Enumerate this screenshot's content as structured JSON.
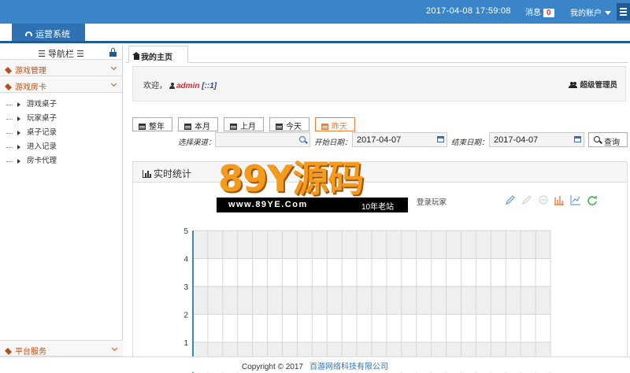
{
  "header": {
    "datetime": "2017-04-08 17:59:08",
    "messages_label": "消息",
    "messages_count": "0",
    "account_label": "我的账户"
  },
  "nav": {
    "system_tab": "运营系统"
  },
  "sidebar": {
    "title": "☰ 导航栏 ☰",
    "groups": [
      {
        "label": "游戏管理"
      },
      {
        "label": "游戏房卡"
      },
      {
        "label": "平台服务"
      }
    ],
    "items": [
      {
        "label": "游戏桌子"
      },
      {
        "label": "玩家桌子"
      },
      {
        "label": "桌子记录"
      },
      {
        "label": "进入记录"
      },
      {
        "label": "房卡代理"
      }
    ]
  },
  "tabs": {
    "home": "我的主页"
  },
  "welcome": {
    "greeting": "欢迎，",
    "username": "admin",
    "ip": "[::1]",
    "role": "超级管理员"
  },
  "filters": {
    "ranges": [
      "整年",
      "本月",
      "上月",
      "今天",
      "昨天"
    ],
    "active_range": "昨天",
    "channel_label": "选择渠道：",
    "channel_value": "",
    "start_label": "开始日期：",
    "start_value": "2017-04-07",
    "end_label": "结束日期：",
    "end_value": "2017-04-07",
    "query_label": "查询"
  },
  "panel": {
    "title": "实时统计",
    "legend_right": "登录玩家"
  },
  "watermark": {
    "logo": "89Y源码",
    "url": "www.89YE.Com",
    "slogan": "10年老站"
  },
  "colors": {
    "topbar": "#3a85c8",
    "accent": "#1f5c94",
    "sidebar_group": "#b8501c",
    "active_filter": "#ef7d3a"
  },
  "chart_data": {
    "type": "line",
    "title": "",
    "ylim": [
      0,
      5
    ],
    "yticks": [
      1,
      2,
      3,
      4,
      5
    ],
    "series": [
      {
        "name": "登录玩家",
        "values": []
      }
    ],
    "grid": true
  },
  "footer": {
    "copyright": "Copyright © 2017",
    "company": "百游网络科技有限公司"
  }
}
